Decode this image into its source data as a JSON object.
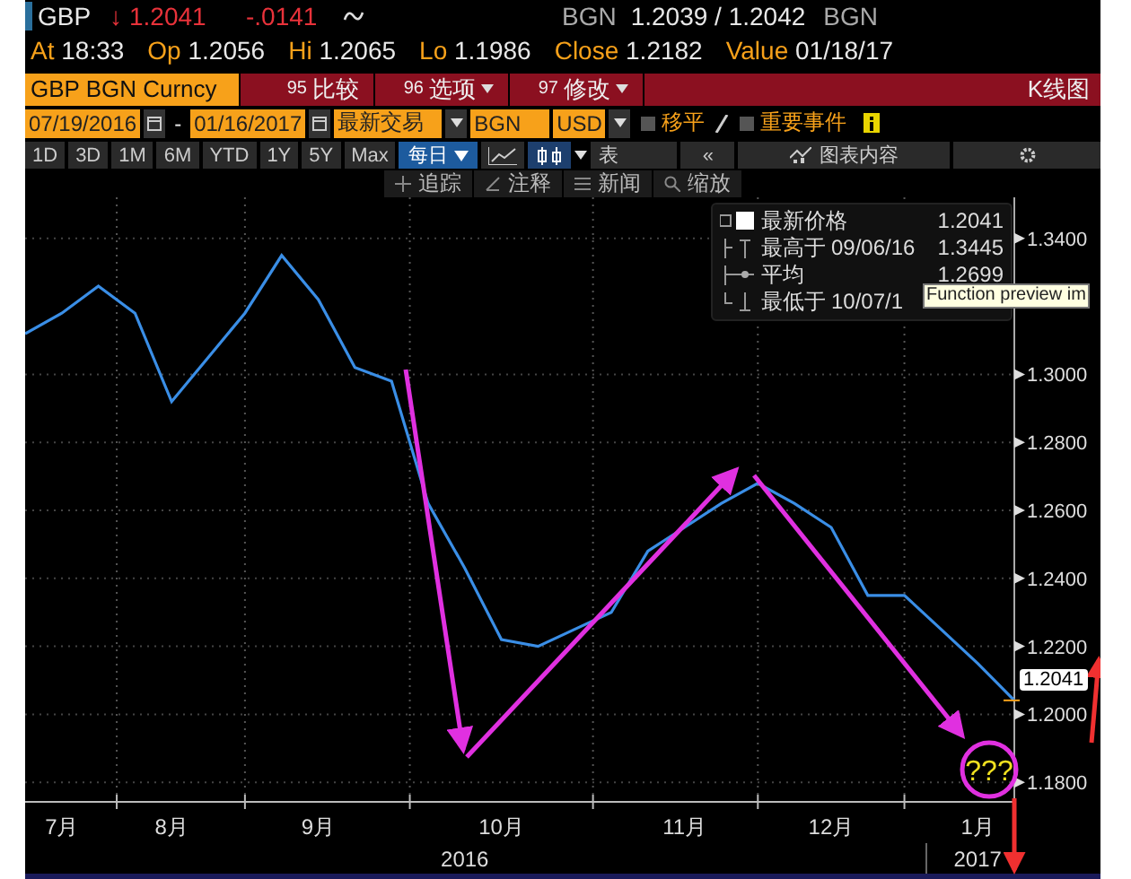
{
  "quote": {
    "ticker": "GBP",
    "arrow": "↓",
    "last": "1.2041",
    "change": "-.0141",
    "bid_source": "BGN",
    "bid_ask": "1.2039 / 1.2042",
    "ask_source": "BGN"
  },
  "stats": [
    {
      "label": "At",
      "value": "18:33"
    },
    {
      "label": "Op",
      "value": "1.2056"
    },
    {
      "label": "Hi",
      "value": "1.2065"
    },
    {
      "label": "Lo",
      "value": "1.1986"
    },
    {
      "label": "Close",
      "value": "1.2182"
    },
    {
      "label": "Value",
      "value": "01/18/17"
    }
  ],
  "security": "GBP BGN Curncy",
  "menu": [
    {
      "number": "95",
      "label": "比较",
      "dropdown": false
    },
    {
      "number": "96",
      "label": "选项",
      "dropdown": true
    },
    {
      "number": "97",
      "label": "修改",
      "dropdown": true
    }
  ],
  "view_title": "K线图",
  "range": {
    "start": "07/19/2016",
    "separator": "-",
    "end": "01/16/2017",
    "price_type": "最新交易",
    "pricing_source": "BGN",
    "currency": "USD"
  },
  "toggles": [
    {
      "label": "移平",
      "checked": false
    },
    {
      "label": "重要事件",
      "checked": false
    }
  ],
  "periods": [
    {
      "label": "1D",
      "selected": false
    },
    {
      "label": "3D",
      "selected": false
    },
    {
      "label": "1M",
      "selected": false
    },
    {
      "label": "6M",
      "selected": false
    },
    {
      "label": "YTD",
      "selected": false
    },
    {
      "label": "1Y",
      "selected": false
    },
    {
      "label": "5Y",
      "selected": false
    },
    {
      "label": "Max",
      "selected": false
    }
  ],
  "frequency": "每日",
  "chart_types": [
    {
      "kind": "line",
      "selected": false
    },
    {
      "kind": "candle",
      "selected": true
    }
  ],
  "table_button": "表",
  "collapse": "«",
  "chart_content": "图表内容",
  "tools": [
    {
      "kind": "track",
      "label": "追踪"
    },
    {
      "kind": "annotate",
      "label": "注释"
    },
    {
      "kind": "news",
      "label": "新闻"
    },
    {
      "kind": "zoom",
      "label": "缩放"
    }
  ],
  "legend": [
    {
      "kind": "last",
      "label": "最新价格",
      "value": "1.2041"
    },
    {
      "kind": "high",
      "label": "最高于",
      "date": "09/06/16",
      "value": "1.3445"
    },
    {
      "kind": "average",
      "label": "平均",
      "value": "1.2699"
    },
    {
      "kind": "low",
      "label": "最低于",
      "date": "10/07/1"
    }
  ],
  "tooltip": "Function preview im",
  "price_marker": "1.2041",
  "years": [
    {
      "label": "2016"
    },
    {
      "label": "2017"
    }
  ],
  "chart_data": {
    "type": "line",
    "series": [
      {
        "color": "#3a8ee6",
        "values": [
          1.312,
          1.318,
          1.326,
          1.318,
          1.292,
          1.305,
          1.318,
          1.335,
          1.322,
          1.302,
          1.298,
          1.262,
          1.243,
          1.222,
          1.22,
          1.225,
          1.23,
          1.248,
          1.255,
          1.262,
          1.268,
          1.262,
          1.255,
          1.235,
          1.235,
          1.225,
          1.215,
          1.2041
        ]
      }
    ],
    "categories": [
      null,
      "7月",
      null,
      null,
      "8月",
      null,
      null,
      null,
      "9月",
      null,
      null,
      null,
      null,
      "10月",
      null,
      null,
      null,
      null,
      "11月",
      null,
      null,
      null,
      "12月",
      null,
      null,
      null,
      "1月",
      null
    ],
    "ylim": [
      1.1753,
      1.3521
    ],
    "grid": true,
    "yticks": [
      {
        "value": 1.18,
        "label": "1.1800"
      },
      {
        "value": 1.2,
        "label": "1.2000"
      },
      {
        "value": 1.22,
        "label": "1.2200"
      },
      {
        "value": 1.24,
        "label": "1.2400"
      },
      {
        "value": 1.26,
        "label": "1.2600"
      },
      {
        "value": 1.28,
        "label": "1.2800"
      },
      {
        "value": 1.3,
        "label": "1.3000"
      },
      {
        "value": 1.34,
        "label": "1.3400"
      }
    ],
    "annotations": [
      {
        "text": "???"
      }
    ]
  }
}
